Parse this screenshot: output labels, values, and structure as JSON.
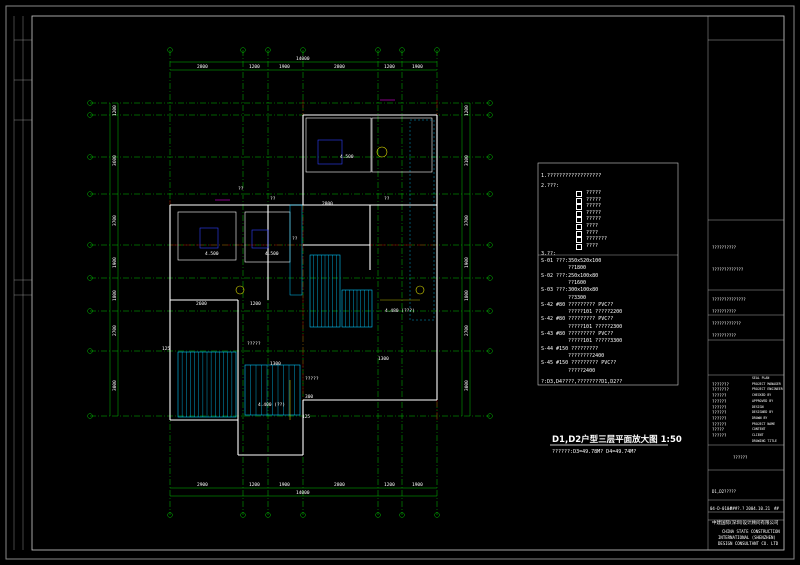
{
  "drawing": {
    "title": "D1,D2户型三层平面放大图 1:50",
    "subtitle": "??????:D3=49.78M? D4=49.74M?",
    "note": "?:D3,D4????,????????D1,D2??"
  },
  "dimensions": {
    "top_total": "14000",
    "top_segments": [
      "2800",
      "1200",
      "1900",
      "2800",
      "1200",
      "1900"
    ],
    "bottom_total": "14000",
    "bottom_segments": [
      "2900",
      "1200",
      "1900",
      "2800",
      "1200",
      "1900"
    ],
    "left_segments": [
      "1200",
      "3600",
      "3700",
      "1900",
      "1800",
      "2700",
      "3000"
    ],
    "right_segments": [
      "1200",
      "3100",
      "3700",
      "1900",
      "1800",
      "2700",
      "3000"
    ],
    "inner_labels": [
      "2600",
      "1200",
      "2800",
      "1300",
      "1300"
    ]
  },
  "plan_labels": {
    "elevations": [
      "4.500",
      "4.500",
      "4.500",
      "4.480 (???)",
      "4.400 (??)"
    ],
    "misc": [
      "??",
      "??",
      "??",
      "??",
      "?????",
      "?????"
    ],
    "numbers": [
      "125",
      "300",
      "125"
    ]
  },
  "legend": {
    "heading1": "1.??????????????????",
    "heading2": "2.???:",
    "icon_items": [
      "?????",
      "?????",
      "?????",
      "?????",
      "?????",
      "????",
      "????",
      "???????",
      "????"
    ],
    "heading3": "3.??:",
    "items": [
      "S-01  ???:350x520x100",
      "??1800",
      "S-02  ???:250x100x80",
      "??1600",
      "S-03  ???:300x100x80",
      "??3300",
      "S-42  #80  ?????????  PVC??",
      "?????101  ?????2200",
      "S-42  #80  ?????????  PVC??",
      "?????101  ?????2300",
      "S-43  #80  ?????????  PVC??",
      "?????101  ?????3300",
      "S-44  #150  ?????????",
      "????????2400",
      "S-45  #150  ?????????  PVC??",
      "?????2400"
    ]
  },
  "right_blank_labels": [
    "??????????",
    "?????????????",
    "??????????????",
    "??????????",
    "????????????",
    "??????????"
  ],
  "title_block": {
    "rows": [
      {
        "left": "",
        "right": "SEAL PLAN"
      },
      {
        "left": "???????",
        "right": "PROJECT MANAGER"
      },
      {
        "left": "???????",
        "right": "PROJECT ENGINEER"
      },
      {
        "left": "??????",
        "right": "CHECKED BY"
      },
      {
        "left": "??????",
        "right": "APPROVED BY"
      },
      {
        "left": "??????",
        "right": "DESIGN"
      },
      {
        "left": "??????",
        "right": "DESIGNED BY"
      },
      {
        "left": "??????",
        "right": "DRAWN BY"
      },
      {
        "left": "??????",
        "right": "PROJECT NAME"
      },
      {
        "left": "?????",
        "right": "CONTENT"
      },
      {
        "left": "??????",
        "right": "CLIENT"
      },
      {
        "left": "",
        "right": "DRAWING TITLE"
      }
    ],
    "project": "??????",
    "drawing_no": "D1,D2?????",
    "footer_codes": [
      "04-D-0104",
      "###?.?",
      "2004.10.21",
      "##"
    ],
    "company_cn": "中建国际(深圳)设计顾问有限公司",
    "company_en1": "CHINA STATE CONSTRUCTION",
    "company_en2": "INTERNATIONAL (SHENZHEN)",
    "company_en3": "DESIGN CONSULTANT CO. LTD"
  },
  "colors": {
    "background": "#000000",
    "grid_green": "#00c000",
    "axis_red": "#e00000",
    "wall_white": "#ffffff",
    "hatch_cyan": "#00c8ff",
    "blue": "#3040ff",
    "yellow": "#e0e000",
    "magenta": "#e000e0"
  }
}
